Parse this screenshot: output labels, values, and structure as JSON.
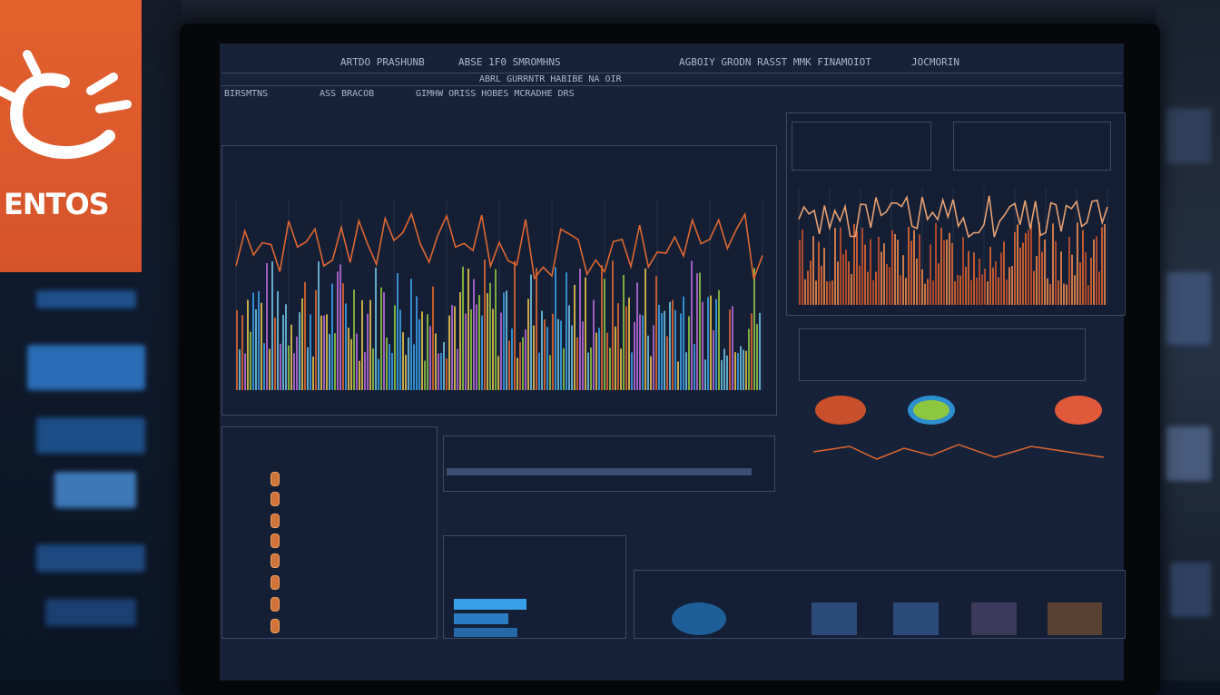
{
  "logo": {
    "text": "ENTOS"
  },
  "colors": {
    "logo_bg": "#e3612e",
    "screen_bg": "#16213a",
    "grid": "#2e3d5a",
    "orange_line": "#e0662e",
    "accent_blue": "#3aa0e8"
  },
  "header": {
    "left_title": "ARTDO PRASHUNB",
    "mid_title": "ABSE 1F0 SMROMHNS",
    "right_title": "AGBOIY GRODN RASST MMK FINAMOIOT",
    "right_tag": "JOCMORIN",
    "sub_center": "ABRL GURRNTR HABIBE NA OIR",
    "sub_left": "BIRSMTNS",
    "sub_mid": "ASS BRACOB",
    "sub_right": "GIMHW ORISS HOBES MCRADHE DRS"
  },
  "icons": [
    "gear-icon",
    "status-dot-icon"
  ]
}
